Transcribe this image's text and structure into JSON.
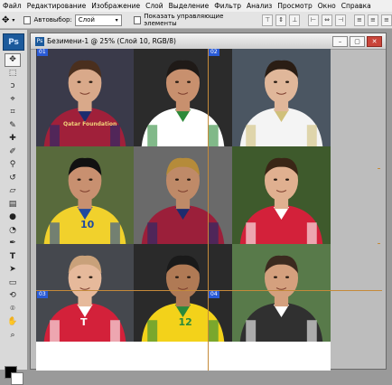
{
  "menu": [
    "Файл",
    "Редактирование",
    "Изображение",
    "Слой",
    "Выделение",
    "Фильтр",
    "Анализ",
    "Просмотр",
    "Окно",
    "Справка"
  ],
  "options": {
    "autoselect_label": "Автовыбор:",
    "autoselect_value": "Слой",
    "show_controls_label": "Показать управляющие элементы"
  },
  "app_logo": "Ps",
  "document": {
    "title": "Безимени-1 @ 25% (Слой 10, RGB/8)",
    "icon": "Ps"
  },
  "slices": [
    "01",
    "02",
    "03",
    "04"
  ],
  "colors": {
    "accent": "#1c5a9c",
    "guide": "#c58a3a",
    "slice": "#2a5bd6"
  },
  "tiles": [
    {
      "jersey": "#a0203a",
      "jersey2": "#1d2c6e",
      "skin": "#d9a98a",
      "hair": "#4a2f1e",
      "bg": "#3a3a4a",
      "text": "Qatar Foundation"
    },
    {
      "jersey": "#ffffff",
      "jersey2": "#2d8a3a",
      "skin": "#c8906e",
      "hair": "#1f1a17",
      "bg": "#2b2b2b",
      "text": ""
    },
    {
      "jersey": "#f4f4f4",
      "jersey2": "#d0c07a",
      "skin": "#e0b79a",
      "hair": "#2a1d14",
      "bg": "#4b5662",
      "text": ""
    },
    {
      "jersey": "#f1d12c",
      "jersey2": "#1f4aa0",
      "skin": "#c89070",
      "hair": "#111111",
      "bg": "#586a3c",
      "text": "10"
    },
    {
      "jersey": "#9b1f3a",
      "jersey2": "#1d2c6e",
      "skin": "#bf8a68",
      "hair": "#b58b3a",
      "bg": "#6a6a6a",
      "text": ""
    },
    {
      "jersey": "#d3213a",
      "jersey2": "#ffffff",
      "skin": "#e0b090",
      "hair": "#3a2616",
      "bg": "#3e5a2c",
      "text": ""
    },
    {
      "jersey": "#d3213a",
      "jersey2": "#ffffff",
      "skin": "#e6b99b",
      "hair": "#c9a17a",
      "bg": "#45484e",
      "text": "T"
    },
    {
      "jersey": "#f3d21a",
      "jersey2": "#2a8a3a",
      "skin": "#b07a55",
      "hair": "#1a1a1a",
      "bg": "#2a2a2a",
      "text": "12"
    },
    {
      "jersey": "#303030",
      "jersey2": "#ffffff",
      "skin": "#d4a07e",
      "hair": "#3b2a1f",
      "bg": "#587a4a",
      "text": ""
    }
  ]
}
